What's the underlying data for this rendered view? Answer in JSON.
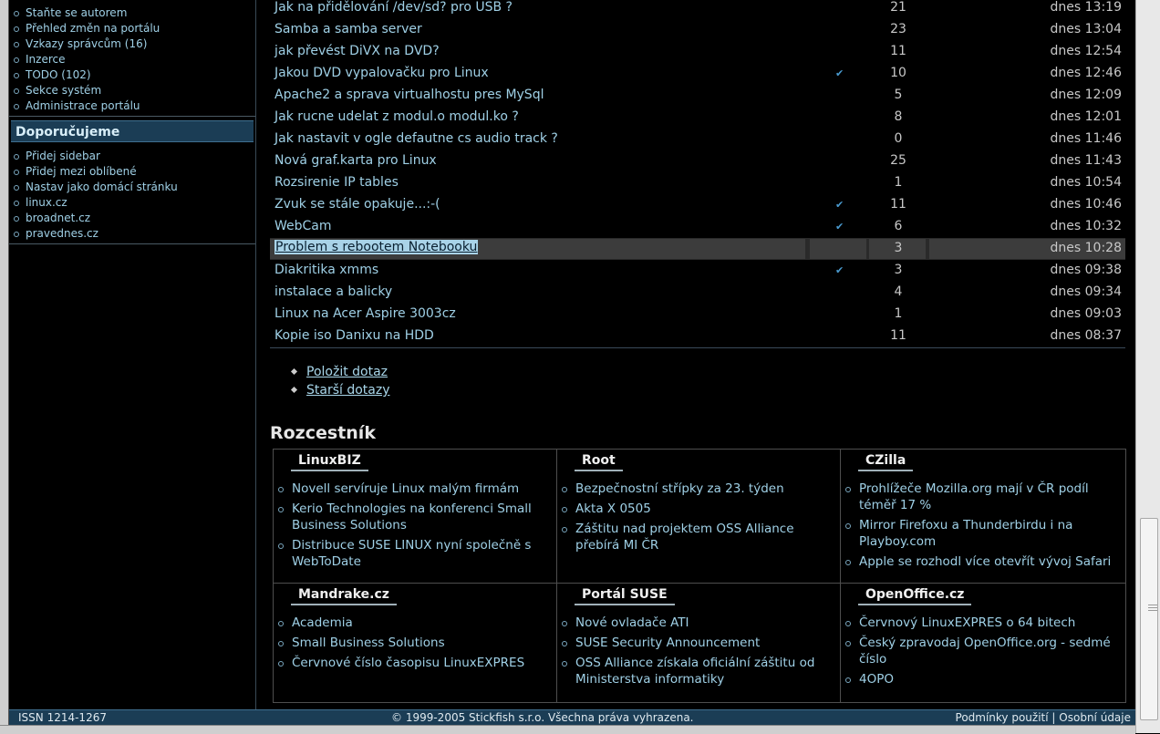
{
  "sidebar": {
    "top_links": [
      "Staňte se autorem",
      "Přehled změn na portálu",
      "Vzkazy správcům (16)",
      "Inzerce",
      "TODO (102)",
      "Sekce systém",
      "Administrace portálu"
    ],
    "recommend_title": "Doporučujeme",
    "recommend_links": [
      "Přidej sidebar",
      "Přidej mezi oblíbené",
      "Nastav jako domácí stránku",
      "linux.cz",
      "broadnet.cz",
      "pravednes.cz"
    ]
  },
  "questions": [
    {
      "title": "Jak na přidělování /dev/sd? pro USB ?",
      "checked": false,
      "count": "21",
      "date": "dnes 13:19"
    },
    {
      "title": "Samba a samba server",
      "checked": false,
      "count": "23",
      "date": "dnes 13:04"
    },
    {
      "title": "jak převést DiVX na DVD?",
      "checked": false,
      "count": "11",
      "date": "dnes 12:54"
    },
    {
      "title": "Jakou DVD vypalovačku pro Linux",
      "checked": true,
      "count": "10",
      "date": "dnes 12:46"
    },
    {
      "title": "Apache2 a sprava virtualhostu pres MySql",
      "checked": false,
      "count": "5",
      "date": "dnes 12:09"
    },
    {
      "title": "Jak rucne udelat z modul.o modul.ko ?",
      "checked": false,
      "count": "8",
      "date": "dnes 12:01"
    },
    {
      "title": "Jak nastavit v ogle defautne cs audio track ?",
      "checked": false,
      "count": "0",
      "date": "dnes 11:46"
    },
    {
      "title": "Nová graf.karta pro Linux",
      "checked": false,
      "count": "25",
      "date": "dnes 11:43"
    },
    {
      "title": "Rozsirenie IP tables",
      "checked": false,
      "count": "1",
      "date": "dnes 10:54"
    },
    {
      "title": "Zvuk se stále opakuje...:-(",
      "checked": true,
      "count": "11",
      "date": "dnes 10:46"
    },
    {
      "title": "WebCam",
      "checked": true,
      "count": "6",
      "date": "dnes 10:32"
    },
    {
      "title": "Problem s rebootem Notebooku",
      "checked": false,
      "count": "3",
      "date": "dnes 10:28"
    },
    {
      "title": "Diakritika xmms",
      "checked": true,
      "count": "3",
      "date": "dnes 09:38"
    },
    {
      "title": "instalace a balicky",
      "checked": false,
      "count": "4",
      "date": "dnes 09:34"
    },
    {
      "title": "Linux na Acer Aspire 3003cz",
      "checked": false,
      "count": "1",
      "date": "dnes 09:03"
    },
    {
      "title": "Kopie iso Danixu na HDD",
      "checked": false,
      "count": "11",
      "date": "dnes 08:37"
    }
  ],
  "actions": [
    "Položit dotaz",
    "Starší dotazy"
  ],
  "rozcestnik": {
    "title": "Rozcestník",
    "sections": [
      {
        "name": "LinuxBIZ",
        "items": [
          "Novell servíruje Linux malým firmám",
          "Kerio Technologies na konferenci Small Business Solutions",
          "Distribuce SUSE LINUX nyní společně s WebToDate"
        ]
      },
      {
        "name": "Root",
        "items": [
          "Bezpečnostní střípky za 23. týden",
          "Akta X 0505",
          "Záštitu nad projektem OSS Alliance přebírá MI ČR"
        ]
      },
      {
        "name": "CZilla",
        "items": [
          "Prohlížeče Mozilla.org mají v ČR podíl téměř 17 %",
          "Mirror Firefoxu a Thunderbirdu i na Playboy.com",
          "Apple se rozhodl více otevřít vývoj Safari"
        ]
      },
      {
        "name": "Mandrake.cz",
        "items": [
          "Academia",
          "Small Business Solutions",
          "Červnové číslo časopisu LinuxEXPRES"
        ]
      },
      {
        "name": "Portál SUSE",
        "items": [
          "Nové ovladače ATI",
          "SUSE Security Announcement",
          "OSS Alliance získala oficiální záštitu od Ministerstva informatiky"
        ]
      },
      {
        "name": "OpenOffice.cz",
        "items": [
          "Červnový LinuxEXPRES o 64 bitech",
          "Český zpravodaj OpenOffice.org - sedmé číslo",
          "4OPO"
        ]
      }
    ]
  },
  "footer": {
    "issn": "ISSN 1214-1267",
    "copyright": "© 1999-2005 Stickfish s.r.o. Všechna práva vyhrazena.",
    "terms": "Podmínky použití",
    "separator": "|",
    "privacy": "Osobní údaje"
  }
}
